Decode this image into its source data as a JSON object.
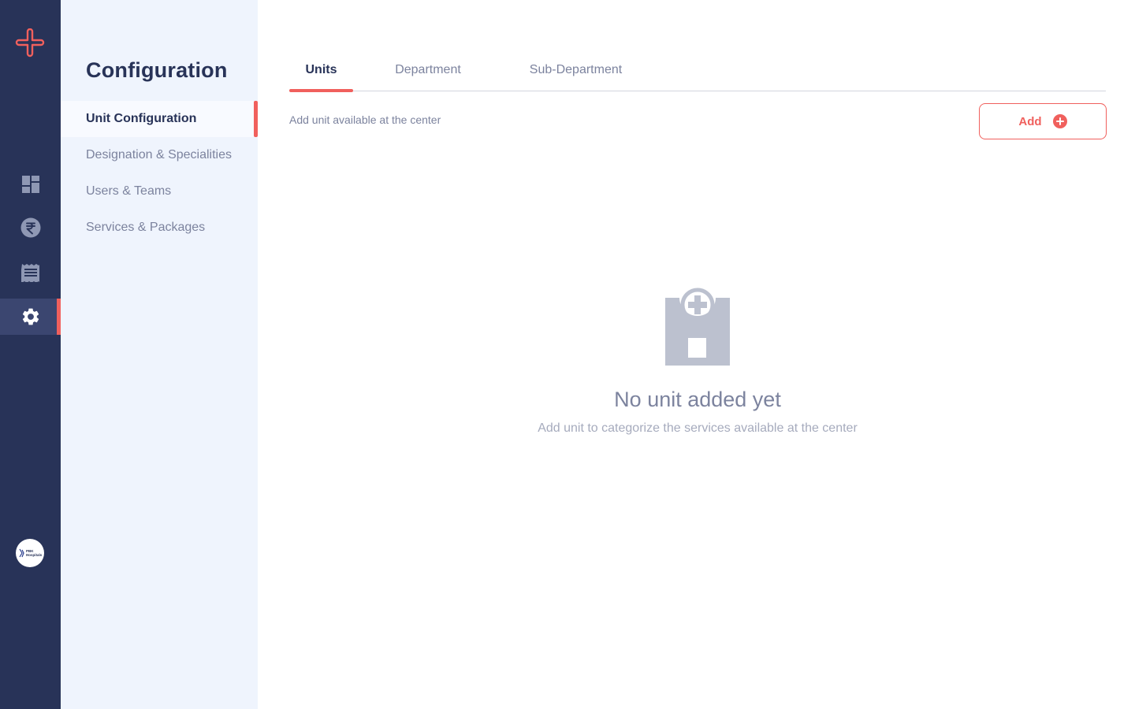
{
  "rail": {
    "logo": "plus-cross-logo-icon",
    "items": [
      {
        "icon": "dashboard-icon"
      },
      {
        "icon": "rupee-icon"
      },
      {
        "icon": "receipt-icon"
      },
      {
        "icon": "gear-icon",
        "active": true
      }
    ],
    "avatar_label": "PBK Hospitals"
  },
  "sidebar": {
    "title": "Configuration",
    "items": [
      {
        "label": "Unit Configuration",
        "active": true
      },
      {
        "label": "Designation & Specialities"
      },
      {
        "label": "Users & Teams"
      },
      {
        "label": "Services & Packages"
      }
    ]
  },
  "main": {
    "tabs": [
      {
        "label": "Units",
        "active": true
      },
      {
        "label": "Department"
      },
      {
        "label": "Sub-Department"
      }
    ],
    "hint": "Add unit available at the center",
    "add_button_label": "Add",
    "empty_state": {
      "icon": "hospital-icon",
      "title": "No unit added yet",
      "subtitle": "Add unit to categorize the services available at the center"
    }
  },
  "colors": {
    "accent": "#f0605d",
    "rail_bg": "#283358",
    "sidebar_bg": "#eff4fd",
    "text_primary": "#283358",
    "text_muted": "#7c839e"
  }
}
